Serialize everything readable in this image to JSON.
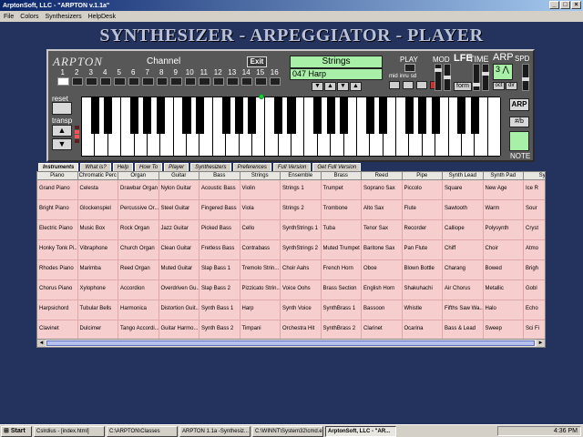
{
  "window": {
    "title": "ArptonSoft, LLC - \"ARPTON v.1.1a\"",
    "min_label": "_",
    "max_label": "□",
    "close_label": "×"
  },
  "menu": [
    "File",
    "Colors",
    "Synthesizers",
    "HelpDesk"
  ],
  "page_title": "SYNTHESIZER - ARPEGGIATOR - PLAYER",
  "panel": {
    "logo": "ARPTON",
    "channel_label": "Channel",
    "channels": [
      "1",
      "2",
      "3",
      "4",
      "5",
      "6",
      "7",
      "8",
      "9",
      "10",
      "11",
      "12",
      "13",
      "14",
      "15",
      "16"
    ],
    "active_channel_index": 0,
    "exit_label": "Exit",
    "instrument_group": "Strings",
    "instrument_name": "047 Harp",
    "arrow_labels": [
      "▼",
      "▲",
      "▼",
      "▲"
    ],
    "play_label": "PLAY",
    "small_labels": [
      "mid",
      "inru",
      "sd"
    ],
    "mod_label": "MOD",
    "lfe_label": "LFE",
    "time_label": "TIME",
    "arp_label": "ARP",
    "spd_label": "SPD",
    "form_label": "form",
    "arp_value": "3",
    "arp_btn_labels": [
      "oct",
      "dir"
    ],
    "reset_label": "reset",
    "transp_label": "transp",
    "transp_up": "▲",
    "transp_down": "▼",
    "arp_side_label": "ARP",
    "sharp_flat_label": "#/b",
    "note_label": "NOTE"
  },
  "tabs": [
    {
      "label": "Instruments",
      "active": true
    },
    {
      "label": "What is?",
      "active": false
    },
    {
      "label": "Help",
      "active": false
    },
    {
      "label": "How To",
      "active": false
    },
    {
      "label": "Player",
      "active": false
    },
    {
      "label": "Synthesizers",
      "active": false
    },
    {
      "label": "Preferences",
      "active": false
    },
    {
      "label": "Full Version",
      "active": false
    },
    {
      "label": "Get Full Version",
      "active": false
    }
  ],
  "grid": {
    "headers": [
      "Piano",
      "Chromatic Perc",
      "Organ",
      "Guitar",
      "Bass",
      "Strings",
      "Ensemble",
      "Brass",
      "Reed",
      "Pipe",
      "Synth Lead",
      "Synth Pad",
      "Syn"
    ],
    "rows": [
      [
        "Grand Piano",
        "Celesta",
        "Drawbar Organ",
        "Nylon Guitar",
        "Acoustic Bass",
        "Violin",
        "Strings 1",
        "Trumpet",
        "Soprano Sax",
        "Piccolo",
        "Square",
        "New Age",
        "Ice R"
      ],
      [
        "Bright Piano",
        "Glockenspiel",
        "Percussive Or...",
        "Steel Guitar",
        "Fingered Bass",
        "Viola",
        "Strings 2",
        "Trombone",
        "Alto Sax",
        "Flute",
        "Sawtooth",
        "Warm",
        "Sour"
      ],
      [
        "Electric Piano",
        "Music Box",
        "Rock Organ",
        "Jazz Guitar",
        "Picked Bass",
        "Cello",
        "SynthStrings 1",
        "Tuba",
        "Tenor Sax",
        "Recorder",
        "Calliope",
        "Polysynth",
        "Cryst"
      ],
      [
        "Honky Tonk Pi...",
        "Vibraphone",
        "Church Organ",
        "Clean Guitar",
        "Fretless Bass",
        "Contrabass",
        "SynthStrings 2",
        "Muted Trumpet",
        "Baritone Sax",
        "Pan Flute",
        "Chiff",
        "Choir",
        "Atmo"
      ],
      [
        "Rhodes Piano",
        "Marimba",
        "Reed Organ",
        "Muted Guitar",
        "Slap Bass 1",
        "Tremolo Strin...",
        "Choir Aahs",
        "French Horn",
        "Oboe",
        "Blown Bottle",
        "Charang",
        "Bowed",
        "Brigh"
      ],
      [
        "Chorus Piano",
        "Xylophone",
        "Accordion",
        "Overdriven Gu...",
        "Slap Bass 2",
        "Pizzicato Strin...",
        "Voice Oohs",
        "Brass Section",
        "English Horn",
        "Shakuhachi",
        "Air Chorus",
        "Metallic",
        "Gobl"
      ],
      [
        "Harpsichord",
        "Tubular Bells",
        "Harmonica",
        "Distortion Guit...",
        "Synth Bass 1",
        "Harp",
        "Synth Voice",
        "SynthBrass 1",
        "Bassoon",
        "Whistle",
        "Fifths Saw Wa...",
        "Halo",
        "Echo"
      ],
      [
        "Clavinet",
        "Dulcimer",
        "Tango Accordi...",
        "Guitar Harmo...",
        "Synth Bass 2",
        "Timpani",
        "Orchestra Hit",
        "SynthBrass 2",
        "Clarinet",
        "Ocarina",
        "Bass & Lead",
        "Sweep",
        "Sci Fi"
      ]
    ]
  },
  "scroll": {
    "left_arrow": "◄",
    "right_arrow": "►"
  },
  "taskbar": {
    "start_label": "Start",
    "tasks": [
      {
        "label": "Cslrdius - [index.html]",
        "active": false
      },
      {
        "label": "C:\\ARPTON\\Classes",
        "active": false
      },
      {
        "label": "ARPTON 1.1a -Synthesiz...",
        "active": false
      },
      {
        "label": "C:\\WINNT\\System32\\cmd.e...",
        "active": false
      },
      {
        "label": "ArptonSoft, LLC - \"AR...",
        "active": true
      }
    ],
    "clock": "4:36 PM"
  }
}
